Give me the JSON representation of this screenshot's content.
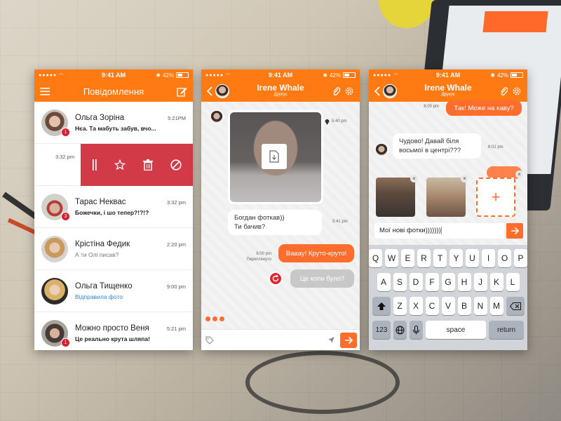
{
  "colors": {
    "accent": "#ff7a12",
    "bubble_out": "#ff6d2d",
    "swipe_bg": "#d23a48",
    "badge": "#d6202f",
    "link_blue": "#2f86d4"
  },
  "status": {
    "time": "9:41 AM",
    "battery": "42%",
    "signal_icon": "signal-dots-icon",
    "wifi_icon": "wifi-icon"
  },
  "screen1": {
    "title": "Повідомлення",
    "swipe_row": {
      "time": "3:32 pm",
      "actions": [
        "bars-icon",
        "star-icon",
        "trash-icon",
        "block-icon"
      ]
    },
    "conversations": [
      {
        "name": "Ольга Зоріна",
        "message": "Нєа. Та мабуть забув, вчо...",
        "time": "5:21PM",
        "badge": "1",
        "style": "bold"
      },
      {
        "name": "Тарас Неквас",
        "message": "Божечки, і шо тепер?!?!?",
        "time": "3:32 pm",
        "badge": "3",
        "style": "bold"
      },
      {
        "name": "Крістіна Федик",
        "message": "А ти Олі писав?",
        "time": "2:20 pm",
        "badge": "",
        "style": "light"
      },
      {
        "name": "Ольга Тищенко",
        "message": "Відправила фото",
        "time": "9:00 pm",
        "badge": "",
        "style": "blue"
      },
      {
        "name": "Можно просто Веня",
        "message": "Це реально крута шляпа!",
        "time": "5:21 pm",
        "badge": "1",
        "style": "bold"
      }
    ]
  },
  "screen2": {
    "contact_name": "Irene Whale",
    "contact_status": "Друкує",
    "photo_time": "5:40 pm",
    "incoming_1": "Богдан фоткав))\nТи бачив?",
    "incoming_1_time": "5:41 pm",
    "outgoing_1": "Вааау! Круто-круто!",
    "outgoing_1_time": "6:00 pm",
    "outgoing_1_status": "Переглянуто",
    "outgoing_failed": "Це копи було?"
  },
  "screen3": {
    "contact_name": "Irene Whale",
    "contact_status": "Друкує",
    "outgoing_top": "Так! Може на каву?",
    "outgoing_top_time": "6:00 pm",
    "incoming": "Чудово! Давай біля\nвосьмої в центрі???",
    "incoming_time": "6:01 pm",
    "compose_text": "Мої нові фотки)))))))",
    "add_label": "+",
    "keyboard": {
      "row1": [
        "Q",
        "W",
        "E",
        "R",
        "T",
        "Y",
        "U",
        "I",
        "O",
        "P"
      ],
      "row2": [
        "A",
        "S",
        "D",
        "F",
        "G",
        "H",
        "J",
        "K",
        "L"
      ],
      "row3": [
        "Z",
        "X",
        "C",
        "V",
        "B",
        "N",
        "M"
      ],
      "n123": "123",
      "space": "space",
      "return": "return"
    }
  }
}
